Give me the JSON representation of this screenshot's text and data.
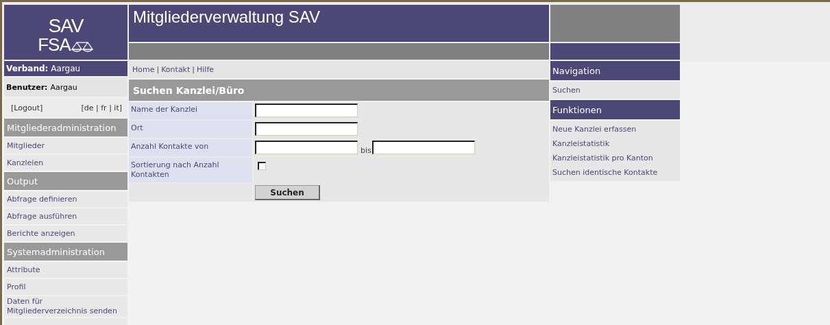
{
  "logo": {
    "line1": "SAV",
    "line2": "FSA"
  },
  "header": {
    "title": "Mitgliederverwaltung SAV"
  },
  "user": {
    "verband_label": "Verband:",
    "verband": "Aargau",
    "benutzer_label": "Benutzer:",
    "benutzer": "Aargau",
    "logout": "[Logout]",
    "languages": "[de | fr | it]"
  },
  "sidebar": [
    {
      "title": "Mitgliederadministration",
      "items": [
        "Mitglieder",
        "Kanzleien"
      ]
    },
    {
      "title": "Output",
      "items": [
        "Abfrage definieren",
        "Abfrage ausführen",
        "Berichte anzeigen"
      ]
    },
    {
      "title": "Systemadministration",
      "items": [
        "Attribute",
        "Profil",
        "Daten für Mitgliederverzeichnis senden"
      ]
    }
  ],
  "breadcrumbs": {
    "links": [
      "Home",
      "Kontakt",
      "Hilfe"
    ],
    "separator": "|"
  },
  "form": {
    "heading": "Suchen Kanzlei/Büro",
    "fields": [
      {
        "kind": "text",
        "label": "Name der Kanzlei"
      },
      {
        "kind": "text",
        "label": "Ort"
      },
      {
        "kind": "range",
        "label": "Anzahl Kontakte von",
        "between": "bis"
      },
      {
        "kind": "checkbox",
        "label": "Sortierung nach Anzahl Kontakten",
        "checked": false
      }
    ],
    "submit": "Suchen"
  },
  "right": [
    {
      "title": "Navigation",
      "items": [
        "Suchen"
      ]
    },
    {
      "title": "Funktionen",
      "items": [
        "Neue Kanzlei erfassen",
        "Kanzleistatistik",
        "Kanzleistatistik pro Kanton",
        "Suchen identische Kontakte"
      ]
    }
  ]
}
